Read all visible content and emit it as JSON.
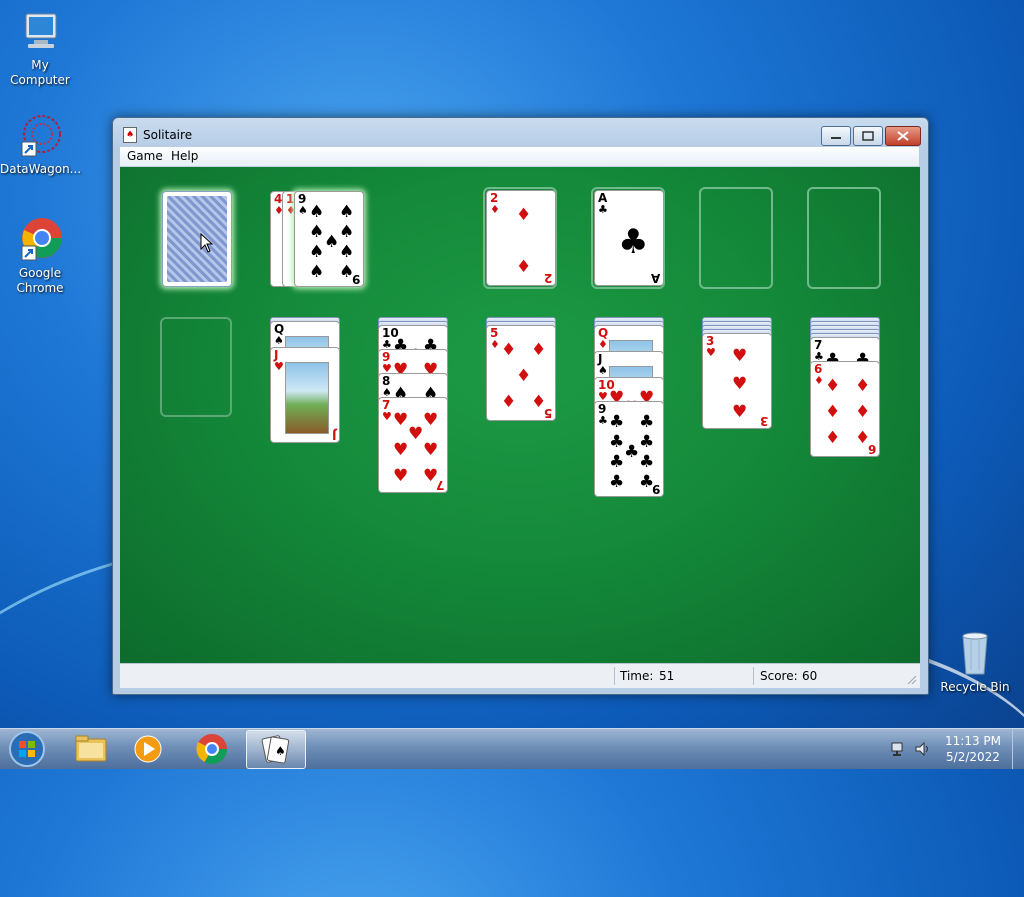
{
  "desktop": {
    "icons": [
      {
        "label": "My Computer"
      },
      {
        "label": "DataWagon..."
      },
      {
        "label": "Google Chrome"
      },
      {
        "label": "Recycle Bin"
      }
    ]
  },
  "window": {
    "title": "Solitaire",
    "menu": [
      "Game",
      "Help"
    ],
    "status": {
      "time_label": "Time:",
      "time_value": "51",
      "score_label": "Score:",
      "score_value": "60"
    }
  },
  "game": {
    "stock": {
      "state": "face-down"
    },
    "waste": [
      {
        "rank": "4",
        "suit": "♦"
      },
      {
        "rank": "10",
        "suit": "♦"
      },
      {
        "rank": "9",
        "suit": "♠"
      }
    ],
    "foundations": [
      {
        "rank": "2",
        "suit": "♦"
      },
      {
        "rank": "A",
        "suit": "♣"
      },
      {
        "rank": "",
        "suit": ""
      },
      {
        "rank": "",
        "suit": ""
      }
    ],
    "tableau": [
      {
        "hidden": 0,
        "cards": []
      },
      {
        "hidden": 1,
        "cards": [
          {
            "rank": "Q",
            "suit": "♠"
          },
          {
            "rank": "J",
            "suit": "♥"
          }
        ]
      },
      {
        "hidden": 2,
        "cards": [
          {
            "rank": "10",
            "suit": "♣"
          },
          {
            "rank": "9",
            "suit": "♥"
          },
          {
            "rank": "8",
            "suit": "♠"
          },
          {
            "rank": "7",
            "suit": "♥"
          }
        ]
      },
      {
        "hidden": 2,
        "cards": [
          {
            "rank": "5",
            "suit": "♦"
          }
        ]
      },
      {
        "hidden": 2,
        "cards": [
          {
            "rank": "Q",
            "suit": "♦"
          },
          {
            "rank": "J",
            "suit": "♠"
          },
          {
            "rank": "10",
            "suit": "♥"
          },
          {
            "rank": "9",
            "suit": "♣"
          }
        ]
      },
      {
        "hidden": 4,
        "cards": [
          {
            "rank": "3",
            "suit": "♥"
          }
        ]
      },
      {
        "hidden": 5,
        "cards": [
          {
            "rank": "7",
            "suit": "♣"
          },
          {
            "rank": "6",
            "suit": "♦"
          }
        ]
      }
    ]
  },
  "taskbar": {
    "clock_time": "11:13 PM",
    "clock_date": "5/2/2022",
    "apps": [
      "start-orb-icon",
      "file-explorer-icon",
      "media-player-icon",
      "chrome-icon",
      "solitaire-icon"
    ]
  },
  "colors": {
    "felt": "#148a3a",
    "desktop": "#1f78d6",
    "red_suit": "#d10f0f"
  }
}
